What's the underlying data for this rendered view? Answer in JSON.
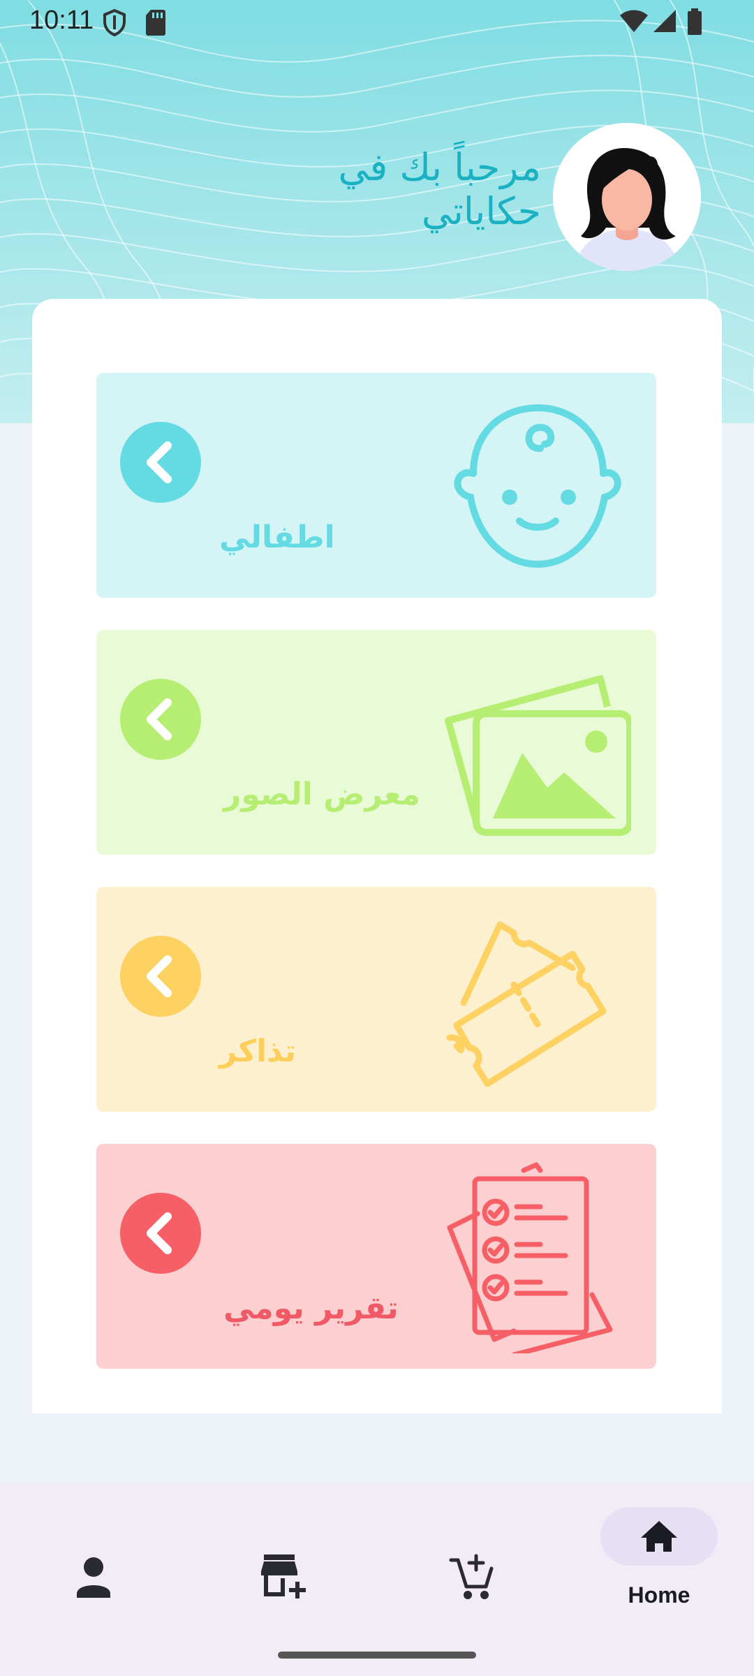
{
  "status_bar": {
    "time": "10:11"
  },
  "header": {
    "welcome": "مرحباً بك في حكاياتي"
  },
  "cards": [
    {
      "label": "اطفالي",
      "bg": "#d5f4f6",
      "accent": "#64dbe3",
      "text_color": "#64dbe3",
      "icon": "baby-face-icon"
    },
    {
      "label": "معرض الصور",
      "bg": "#e9fad7",
      "accent": "#b6ee73",
      "text_color": "#b6ee73",
      "icon": "photo-gallery-icon"
    },
    {
      "label": "تذاكر",
      "bg": "#fdf0cf",
      "accent": "#fdd162",
      "text_color": "#fdcf5a",
      "icon": "tickets-icon"
    },
    {
      "label": "تقرير يومي",
      "bg": "#fccfd1",
      "accent": "#f75f66",
      "text_color": "#f05a66",
      "icon": "daily-report-icon"
    }
  ],
  "bottom_nav": {
    "items": [
      {
        "icon": "person-icon"
      },
      {
        "icon": "add-store-icon"
      },
      {
        "icon": "add-cart-icon"
      },
      {
        "icon": "home-icon",
        "label": "Home",
        "active": true
      }
    ]
  }
}
